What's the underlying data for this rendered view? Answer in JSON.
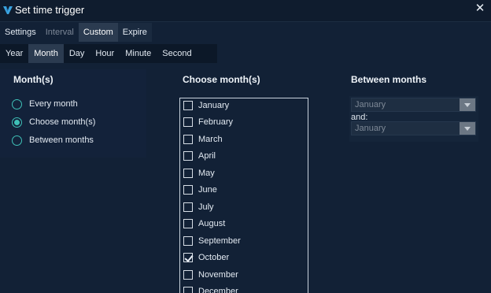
{
  "window": {
    "title": "Set time trigger",
    "close_icon": "close-icon",
    "logo_icon": "app-logo-icon"
  },
  "tabs_primary": [
    {
      "label": "Settings",
      "state": "normal"
    },
    {
      "label": "Interval",
      "state": "disabled"
    },
    {
      "label": "Custom",
      "state": "active"
    },
    {
      "label": "Expire",
      "state": "normal"
    }
  ],
  "tabs_secondary": [
    {
      "label": "Year",
      "state": "normal"
    },
    {
      "label": "Month",
      "state": "active"
    },
    {
      "label": "Day",
      "state": "normal"
    },
    {
      "label": "Hour",
      "state": "normal"
    },
    {
      "label": "Minute",
      "state": "normal"
    },
    {
      "label": "Second",
      "state": "normal"
    }
  ],
  "months_panel": {
    "title": "Month(s)",
    "options": [
      {
        "label": "Every month",
        "checked": false
      },
      {
        "label": "Choose month(s)",
        "checked": true
      },
      {
        "label": "Between months",
        "checked": false
      }
    ]
  },
  "choose_panel": {
    "title": "Choose month(s)",
    "months": [
      {
        "label": "January",
        "checked": false
      },
      {
        "label": "February",
        "checked": false
      },
      {
        "label": "March",
        "checked": false
      },
      {
        "label": "April",
        "checked": false
      },
      {
        "label": "May",
        "checked": false
      },
      {
        "label": "June",
        "checked": false
      },
      {
        "label": "July",
        "checked": false
      },
      {
        "label": "August",
        "checked": false
      },
      {
        "label": "September",
        "checked": false
      },
      {
        "label": "October",
        "checked": true
      },
      {
        "label": "November",
        "checked": false
      },
      {
        "label": "December",
        "checked": false
      }
    ]
  },
  "between_panel": {
    "title": "Between months",
    "from_value": "January",
    "and_label": "and:",
    "to_value": "January"
  },
  "colors": {
    "background": "#122136",
    "accent": "#3fc0b7",
    "active_tab": "#2b3b50"
  }
}
